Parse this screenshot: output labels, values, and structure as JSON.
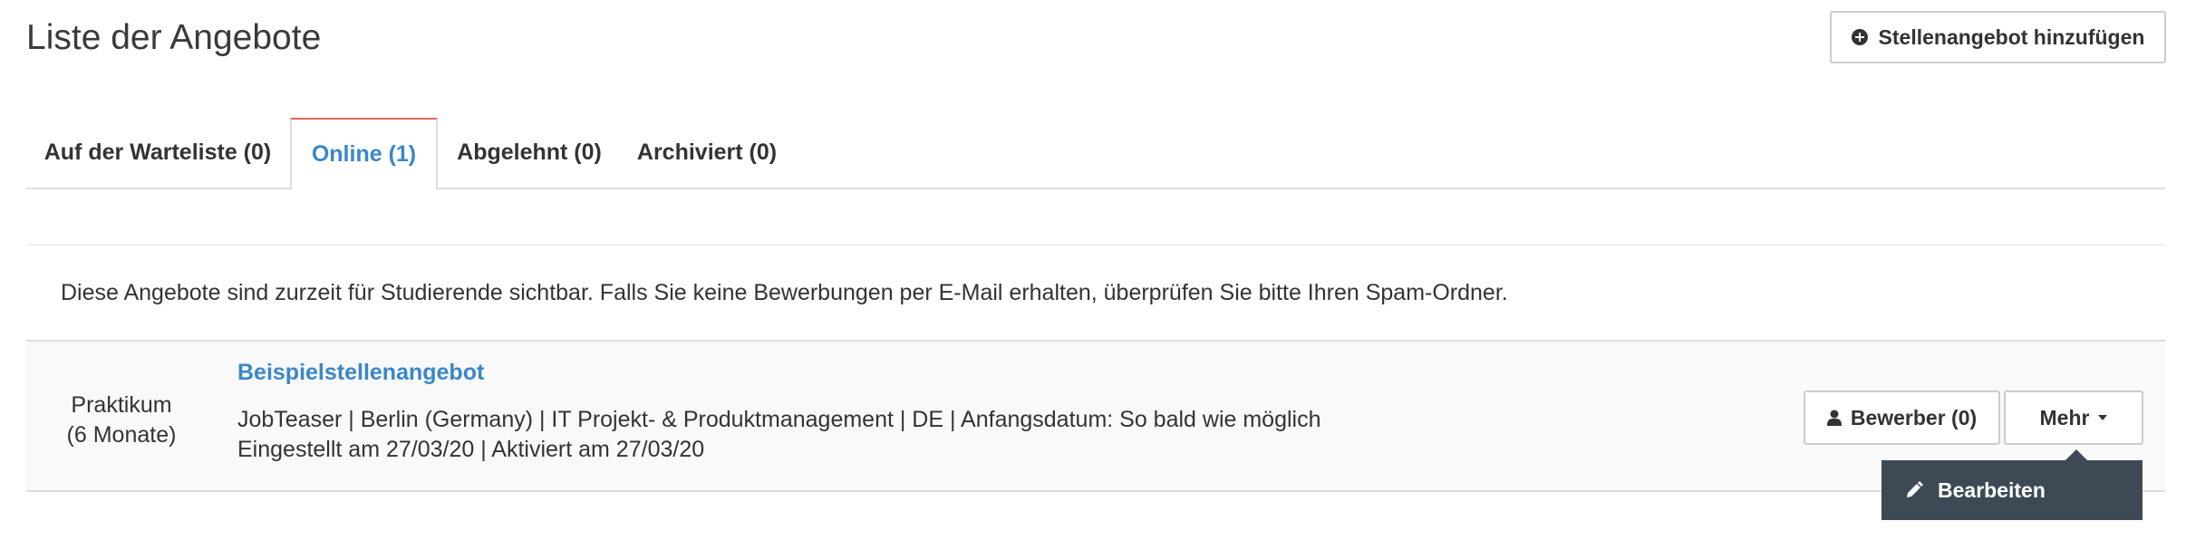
{
  "header": {
    "title": "Liste der Angebote",
    "add_button_label": "Stellenangebot hinzufügen",
    "add_button_icon": "plus-circle-icon"
  },
  "tabs": [
    {
      "label": "Auf der Warteliste (0)",
      "active": false
    },
    {
      "label": "Online (1)",
      "active": true
    },
    {
      "label": "Abgelehnt (0)",
      "active": false
    },
    {
      "label": "Archiviert (0)",
      "active": false
    }
  ],
  "main": {
    "info_text": "Diese Angebote sind zurzeit für Studierende sichtbar. Falls Sie keine Bewerbungen per E-Mail erhalten, überprüfen Sie bitte Ihren Spam-Ordner.",
    "offers": [
      {
        "type_line1": "Praktikum",
        "type_line2": "(6 Monate)",
        "title": "Beispielstellenangebot",
        "details_line1": "JobTeaser | Berlin (Germany) | IT Projekt- & Produktmanagement | DE | Anfangsdatum: So bald wie möglich",
        "details_line2": "Eingestellt am 27/03/20 | Aktiviert am 27/03/20",
        "applicants_button_label": "Bewerber (0)",
        "more_button_label": "Mehr",
        "dropdown_items": [
          {
            "label": "Bearbeiten",
            "icon": "pencil-icon"
          }
        ]
      }
    ]
  },
  "colors": {
    "accent_blue": "#3a87c8",
    "active_tab_border": "#e5675f",
    "dropdown_bg": "#3d4a56"
  }
}
